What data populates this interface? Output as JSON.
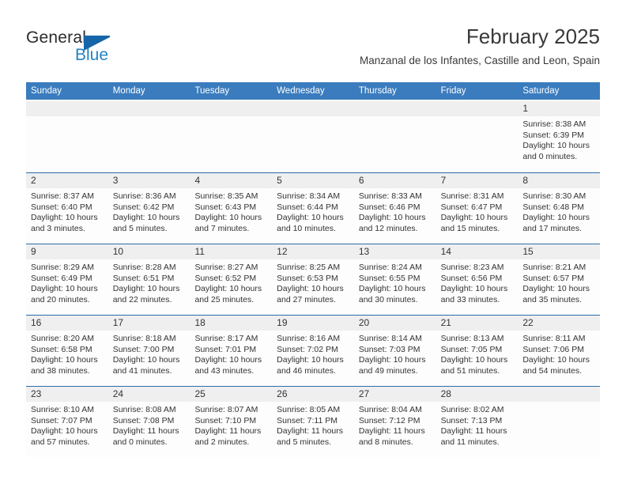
{
  "brand": {
    "name_part1": "General",
    "name_part2": "Blue",
    "flag_icon": "blue-flag-triangle",
    "accent_color": "#1565a8",
    "secondary_color": "#2283c5"
  },
  "header": {
    "title": "February 2025",
    "subtitle": "Manzanal de los Infantes, Castille and Leon, Spain"
  },
  "theme": {
    "header_row_bg": "#3a7cbe",
    "row_divider": "#2c6da6",
    "daynum_band_bg": "#efefef",
    "cell_bg": "#fdfdfd",
    "text": "#333333"
  },
  "weekday_headers": [
    "Sunday",
    "Monday",
    "Tuesday",
    "Wednesday",
    "Thursday",
    "Friday",
    "Saturday"
  ],
  "weeks": [
    [
      {
        "day": "",
        "empty": true,
        "sunrise": "",
        "sunset": "",
        "daylight_line1": "",
        "daylight_line2": ""
      },
      {
        "day": "",
        "empty": true,
        "sunrise": "",
        "sunset": "",
        "daylight_line1": "",
        "daylight_line2": ""
      },
      {
        "day": "",
        "empty": true,
        "sunrise": "",
        "sunset": "",
        "daylight_line1": "",
        "daylight_line2": ""
      },
      {
        "day": "",
        "empty": true,
        "sunrise": "",
        "sunset": "",
        "daylight_line1": "",
        "daylight_line2": ""
      },
      {
        "day": "",
        "empty": true,
        "sunrise": "",
        "sunset": "",
        "daylight_line1": "",
        "daylight_line2": ""
      },
      {
        "day": "",
        "empty": true,
        "sunrise": "",
        "sunset": "",
        "daylight_line1": "",
        "daylight_line2": ""
      },
      {
        "day": "1",
        "empty": false,
        "sunrise": "Sunrise: 8:38 AM",
        "sunset": "Sunset: 6:39 PM",
        "daylight_line1": "Daylight: 10 hours",
        "daylight_line2": "and 0 minutes."
      }
    ],
    [
      {
        "day": "2",
        "empty": false,
        "sunrise": "Sunrise: 8:37 AM",
        "sunset": "Sunset: 6:40 PM",
        "daylight_line1": "Daylight: 10 hours",
        "daylight_line2": "and 3 minutes."
      },
      {
        "day": "3",
        "empty": false,
        "sunrise": "Sunrise: 8:36 AM",
        "sunset": "Sunset: 6:42 PM",
        "daylight_line1": "Daylight: 10 hours",
        "daylight_line2": "and 5 minutes."
      },
      {
        "day": "4",
        "empty": false,
        "sunrise": "Sunrise: 8:35 AM",
        "sunset": "Sunset: 6:43 PM",
        "daylight_line1": "Daylight: 10 hours",
        "daylight_line2": "and 7 minutes."
      },
      {
        "day": "5",
        "empty": false,
        "sunrise": "Sunrise: 8:34 AM",
        "sunset": "Sunset: 6:44 PM",
        "daylight_line1": "Daylight: 10 hours",
        "daylight_line2": "and 10 minutes."
      },
      {
        "day": "6",
        "empty": false,
        "sunrise": "Sunrise: 8:33 AM",
        "sunset": "Sunset: 6:46 PM",
        "daylight_line1": "Daylight: 10 hours",
        "daylight_line2": "and 12 minutes."
      },
      {
        "day": "7",
        "empty": false,
        "sunrise": "Sunrise: 8:31 AM",
        "sunset": "Sunset: 6:47 PM",
        "daylight_line1": "Daylight: 10 hours",
        "daylight_line2": "and 15 minutes."
      },
      {
        "day": "8",
        "empty": false,
        "sunrise": "Sunrise: 8:30 AM",
        "sunset": "Sunset: 6:48 PM",
        "daylight_line1": "Daylight: 10 hours",
        "daylight_line2": "and 17 minutes."
      }
    ],
    [
      {
        "day": "9",
        "empty": false,
        "sunrise": "Sunrise: 8:29 AM",
        "sunset": "Sunset: 6:49 PM",
        "daylight_line1": "Daylight: 10 hours",
        "daylight_line2": "and 20 minutes."
      },
      {
        "day": "10",
        "empty": false,
        "sunrise": "Sunrise: 8:28 AM",
        "sunset": "Sunset: 6:51 PM",
        "daylight_line1": "Daylight: 10 hours",
        "daylight_line2": "and 22 minutes."
      },
      {
        "day": "11",
        "empty": false,
        "sunrise": "Sunrise: 8:27 AM",
        "sunset": "Sunset: 6:52 PM",
        "daylight_line1": "Daylight: 10 hours",
        "daylight_line2": "and 25 minutes."
      },
      {
        "day": "12",
        "empty": false,
        "sunrise": "Sunrise: 8:25 AM",
        "sunset": "Sunset: 6:53 PM",
        "daylight_line1": "Daylight: 10 hours",
        "daylight_line2": "and 27 minutes."
      },
      {
        "day": "13",
        "empty": false,
        "sunrise": "Sunrise: 8:24 AM",
        "sunset": "Sunset: 6:55 PM",
        "daylight_line1": "Daylight: 10 hours",
        "daylight_line2": "and 30 minutes."
      },
      {
        "day": "14",
        "empty": false,
        "sunrise": "Sunrise: 8:23 AM",
        "sunset": "Sunset: 6:56 PM",
        "daylight_line1": "Daylight: 10 hours",
        "daylight_line2": "and 33 minutes."
      },
      {
        "day": "15",
        "empty": false,
        "sunrise": "Sunrise: 8:21 AM",
        "sunset": "Sunset: 6:57 PM",
        "daylight_line1": "Daylight: 10 hours",
        "daylight_line2": "and 35 minutes."
      }
    ],
    [
      {
        "day": "16",
        "empty": false,
        "sunrise": "Sunrise: 8:20 AM",
        "sunset": "Sunset: 6:58 PM",
        "daylight_line1": "Daylight: 10 hours",
        "daylight_line2": "and 38 minutes."
      },
      {
        "day": "17",
        "empty": false,
        "sunrise": "Sunrise: 8:18 AM",
        "sunset": "Sunset: 7:00 PM",
        "daylight_line1": "Daylight: 10 hours",
        "daylight_line2": "and 41 minutes."
      },
      {
        "day": "18",
        "empty": false,
        "sunrise": "Sunrise: 8:17 AM",
        "sunset": "Sunset: 7:01 PM",
        "daylight_line1": "Daylight: 10 hours",
        "daylight_line2": "and 43 minutes."
      },
      {
        "day": "19",
        "empty": false,
        "sunrise": "Sunrise: 8:16 AM",
        "sunset": "Sunset: 7:02 PM",
        "daylight_line1": "Daylight: 10 hours",
        "daylight_line2": "and 46 minutes."
      },
      {
        "day": "20",
        "empty": false,
        "sunrise": "Sunrise: 8:14 AM",
        "sunset": "Sunset: 7:03 PM",
        "daylight_line1": "Daylight: 10 hours",
        "daylight_line2": "and 49 minutes."
      },
      {
        "day": "21",
        "empty": false,
        "sunrise": "Sunrise: 8:13 AM",
        "sunset": "Sunset: 7:05 PM",
        "daylight_line1": "Daylight: 10 hours",
        "daylight_line2": "and 51 minutes."
      },
      {
        "day": "22",
        "empty": false,
        "sunrise": "Sunrise: 8:11 AM",
        "sunset": "Sunset: 7:06 PM",
        "daylight_line1": "Daylight: 10 hours",
        "daylight_line2": "and 54 minutes."
      }
    ],
    [
      {
        "day": "23",
        "empty": false,
        "sunrise": "Sunrise: 8:10 AM",
        "sunset": "Sunset: 7:07 PM",
        "daylight_line1": "Daylight: 10 hours",
        "daylight_line2": "and 57 minutes."
      },
      {
        "day": "24",
        "empty": false,
        "sunrise": "Sunrise: 8:08 AM",
        "sunset": "Sunset: 7:08 PM",
        "daylight_line1": "Daylight: 11 hours",
        "daylight_line2": "and 0 minutes."
      },
      {
        "day": "25",
        "empty": false,
        "sunrise": "Sunrise: 8:07 AM",
        "sunset": "Sunset: 7:10 PM",
        "daylight_line1": "Daylight: 11 hours",
        "daylight_line2": "and 2 minutes."
      },
      {
        "day": "26",
        "empty": false,
        "sunrise": "Sunrise: 8:05 AM",
        "sunset": "Sunset: 7:11 PM",
        "daylight_line1": "Daylight: 11 hours",
        "daylight_line2": "and 5 minutes."
      },
      {
        "day": "27",
        "empty": false,
        "sunrise": "Sunrise: 8:04 AM",
        "sunset": "Sunset: 7:12 PM",
        "daylight_line1": "Daylight: 11 hours",
        "daylight_line2": "and 8 minutes."
      },
      {
        "day": "28",
        "empty": false,
        "sunrise": "Sunrise: 8:02 AM",
        "sunset": "Sunset: 7:13 PM",
        "daylight_line1": "Daylight: 11 hours",
        "daylight_line2": "and 11 minutes."
      },
      {
        "day": "",
        "empty": true,
        "sunrise": "",
        "sunset": "",
        "daylight_line1": "",
        "daylight_line2": ""
      }
    ]
  ]
}
